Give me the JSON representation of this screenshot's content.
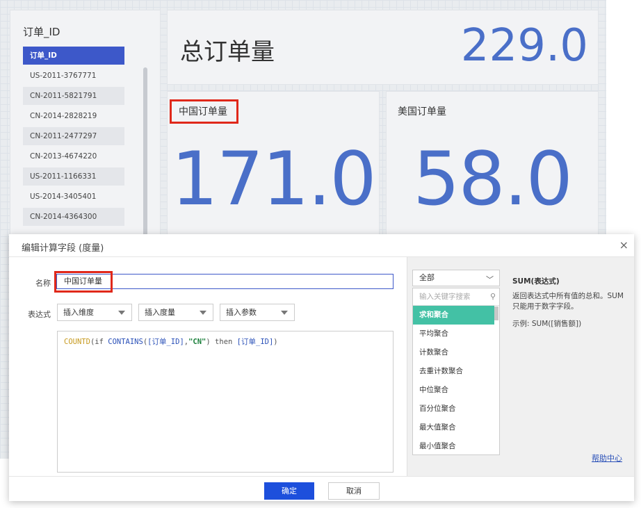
{
  "filter": {
    "title": "订单_ID",
    "items": [
      "订单_ID",
      "US-2011-3767771",
      "CN-2011-5821791",
      "CN-2014-2828219",
      "CN-2011-2477297",
      "CN-2013-4674220",
      "US-2011-1166331",
      "US-2014-3405401",
      "CN-2014-4364300"
    ]
  },
  "total": {
    "label": "总订单量",
    "value": "229.0"
  },
  "cn_card": {
    "label": "中国订单量",
    "value": "171.0"
  },
  "us_card": {
    "label": "美国订单量",
    "value": "58.0"
  },
  "dialog": {
    "title": "编辑计算字段 (度量)",
    "close": "×",
    "name_label": "名称",
    "name_value": "中国订单量",
    "expr_label": "表达式",
    "insert_dimension": "插入维度",
    "insert_measure": "插入度量",
    "insert_param": "插入参数",
    "expression": {
      "fn": "COUNTD",
      "p1": "(",
      "kw_if": "if",
      "fn2": "CONTAINS",
      "p2": "(",
      "field1": "[订单_ID]",
      "comma": ",",
      "str": "\"CN\"",
      "p3": ")",
      "kw_then": "then",
      "field2": "[订单_ID]",
      "p4": ")"
    },
    "category": "全部",
    "search_placeholder": "输入关键字搜索",
    "functions": [
      "求和聚合",
      "平均聚合",
      "计数聚合",
      "去重计数聚合",
      "中位聚合",
      "百分位聚合",
      "最大值聚合",
      "最小值聚合"
    ],
    "desc_title": "SUM(表达式)",
    "desc_body": "返回表达式中所有值的总和。SUM 只能用于数字字段。",
    "desc_example": "示例: SUM([销售额])",
    "help": "帮助中心",
    "ok": "确定",
    "cancel": "取消"
  },
  "colors": {
    "accent": "#3d58c9",
    "kpi": "#4a6fc8",
    "highlight": "#e0281a",
    "active_fn": "#43c1a5",
    "ok_button": "#1d4fdc"
  }
}
